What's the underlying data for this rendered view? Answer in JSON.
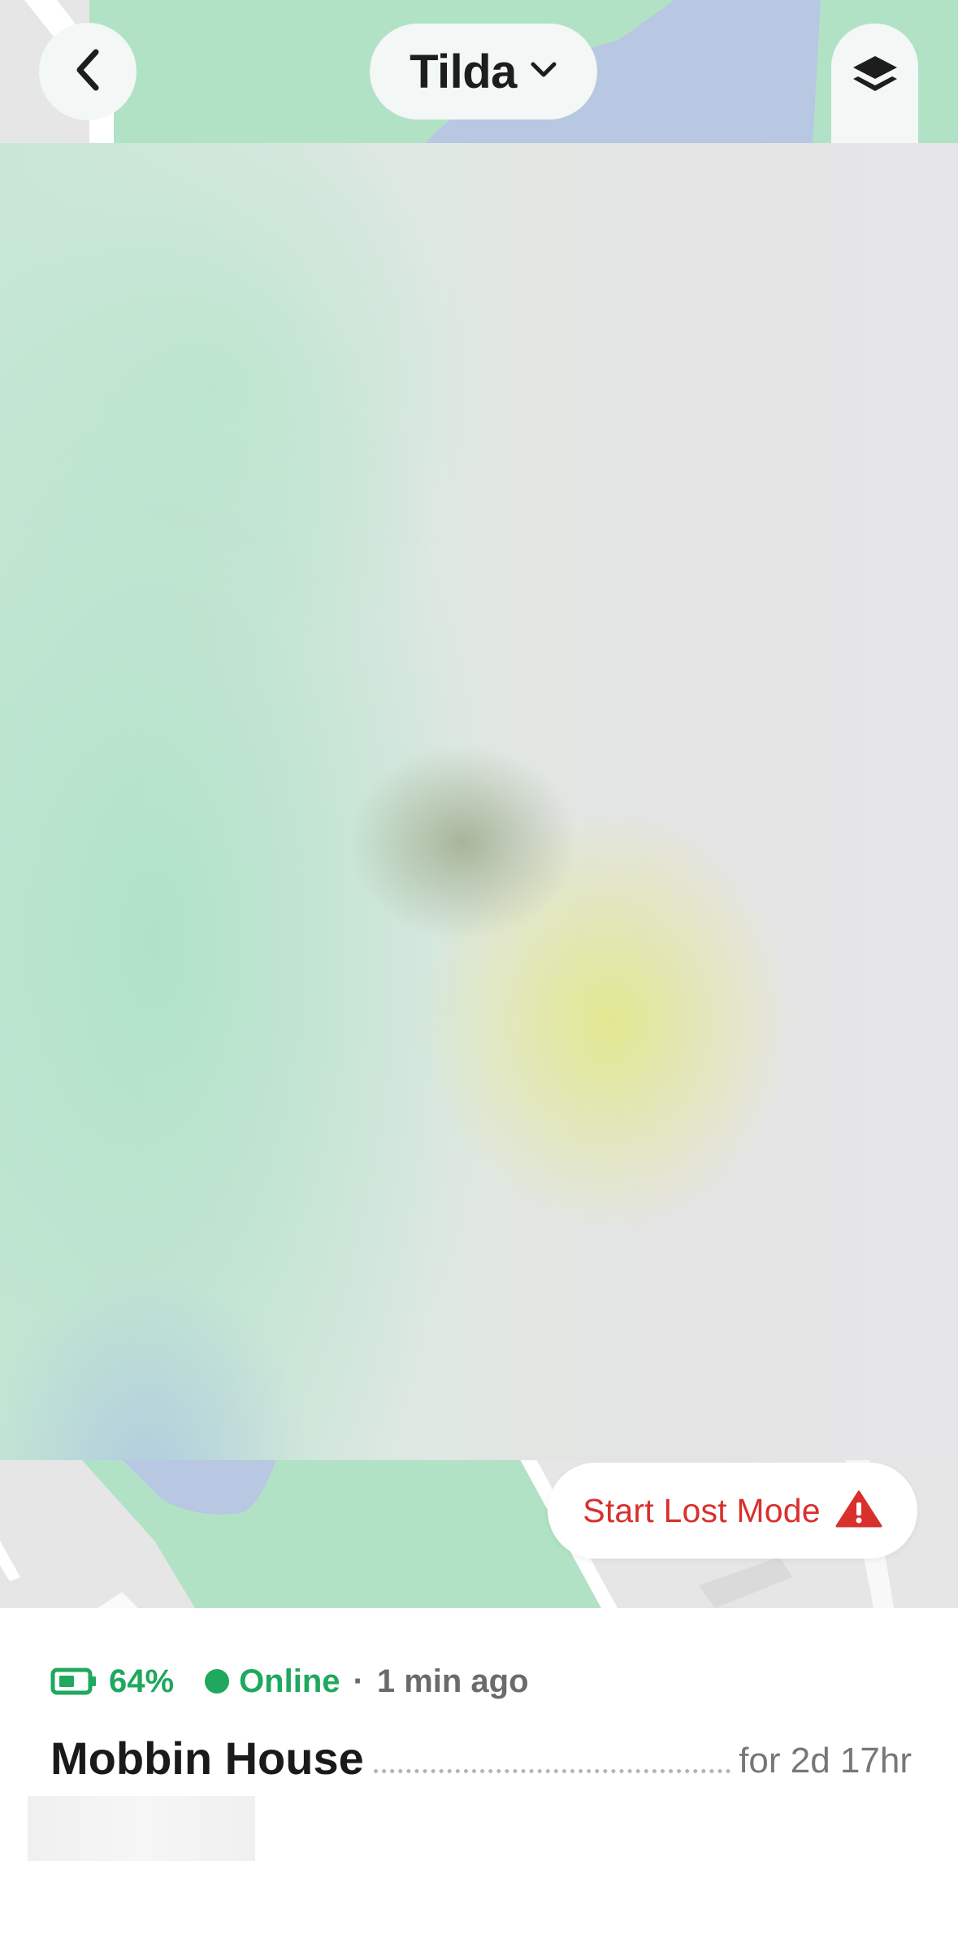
{
  "header": {
    "device_name": "Tilda",
    "icons": {
      "back": "chevron-left-icon",
      "dropdown": "chevron-down-icon",
      "layers": "layers-icon"
    }
  },
  "map": {
    "lost_mode_label": "Start Lost Mode",
    "lost_mode_icon": "warning-triangle-icon",
    "accent_color": "#d8302c"
  },
  "status": {
    "battery": "64%",
    "online_label": "Online",
    "separator": "·",
    "last_seen": "1 min ago",
    "status_color": "#1fa85e"
  },
  "location": {
    "place": "Mobbin House",
    "duration": "for 2d 17hr"
  }
}
